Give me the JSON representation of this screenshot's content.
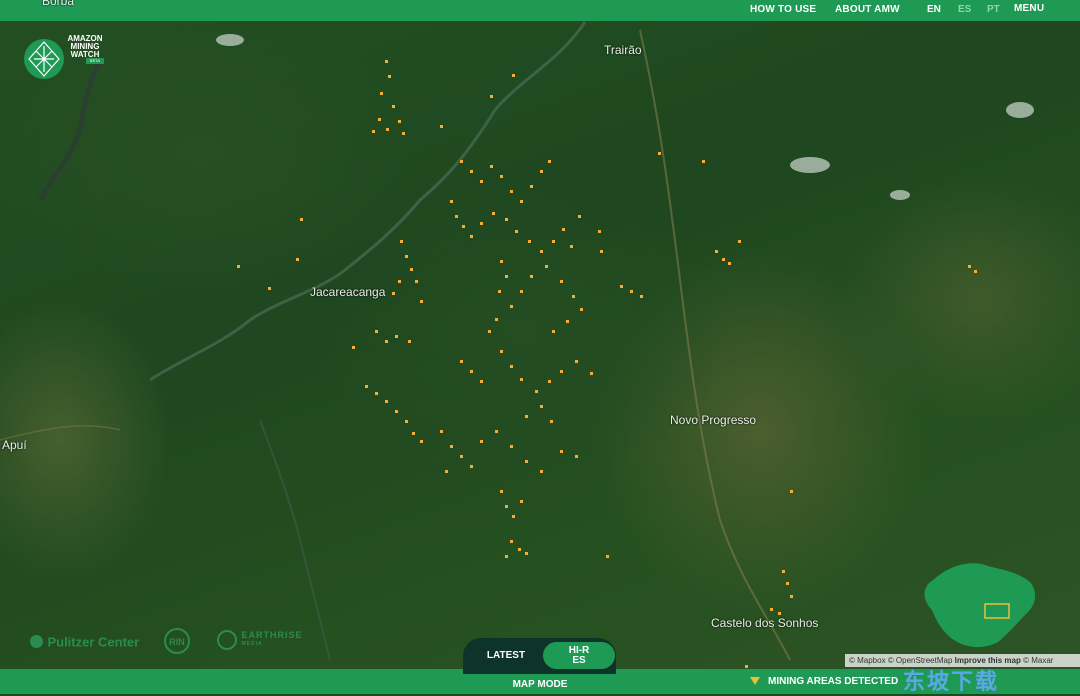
{
  "header": {
    "nav": [
      "HOW TO USE",
      "ABOUT AMW"
    ],
    "languages": [
      "EN",
      "ES",
      "PT"
    ],
    "menu": "MENU",
    "top_left_place": "Borba"
  },
  "logo": {
    "text": "AMAZON MINING WATCH",
    "badge": "BETA"
  },
  "places": [
    "Trairão",
    "Jacareacanga",
    "Novo Progresso",
    "Apuí",
    "Castelo dos Sonhos"
  ],
  "partners": [
    "Pulitzer Center",
    "RIN",
    "EARTHRISE",
    "MEDIA"
  ],
  "map_mode": {
    "options": [
      "LATEST",
      "HI-RES"
    ],
    "active": "HI-RES",
    "label": "MAP MODE"
  },
  "legend": {
    "label": "MINING AREAS DETECTED",
    "color": "#f2ae38"
  },
  "attribution": [
    "© Mapbox",
    "© OpenStreetMap",
    "Improve this map",
    "© Maxar"
  ],
  "watermark": "东坡下载",
  "colors": {
    "brand": "#1f9a55",
    "toggle_bg": "#0e3328",
    "mining": "#f2ae38",
    "minimap_land": "#1f9a55",
    "minimap_box": "#e8c13a"
  }
}
